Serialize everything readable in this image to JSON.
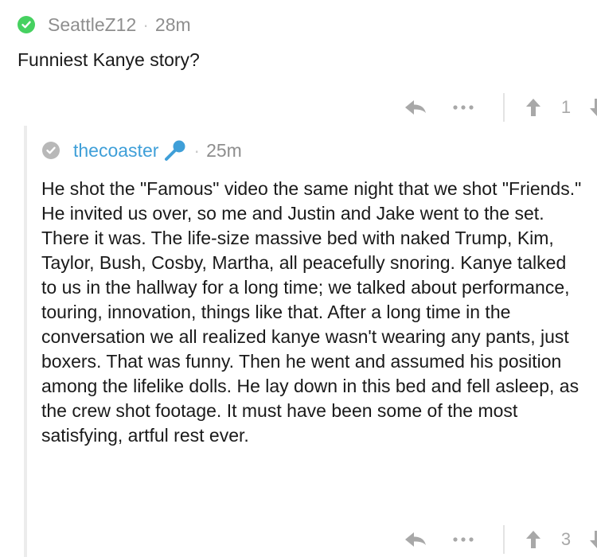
{
  "colors": {
    "text": "#1a1a1a",
    "muted": "#8e8e8e",
    "icon_gray": "#a8a8a8",
    "verified_green": "#46d160",
    "verified_gray": "#b8b8b8",
    "link_blue": "#3f9fd8",
    "thread_line": "#ececec"
  },
  "top_comment": {
    "badge_icon": "check-circle-icon",
    "username": "SeattleZ12",
    "separator": "·",
    "timestamp": "28m",
    "title": "Funniest Kanye story?",
    "actions": {
      "reply_icon": "reply-arrow-icon",
      "more_icon": "more-dots-icon",
      "more_label": "•••",
      "upvote_icon": "arrow-up-icon",
      "score": "1",
      "downvote_icon": "arrow-down-icon"
    }
  },
  "reply": {
    "badge_icon": "check-circle-icon",
    "username": "thecoaster",
    "flair_icon": "microphone-icon",
    "separator": "·",
    "timestamp": "25m",
    "body": "He shot the \"Famous\" video the same night that we shot \"Friends.\" He invited us over, so me and Justin and Jake went to the set. There it was. The life-size massive bed with naked Trump, Kim, Taylor, Bush, Cosby, Martha, all peacefully snoring. Kanye talked to us in the hallway for a long time; we talked about performance, touring, innovation, things like that. After a long time in the conversation we all realized kanye wasn't wearing any pants, just boxers. That was funny. Then he went and assumed his position among the lifelike dolls. He lay down in this bed and fell asleep, as the crew shot footage. It must have been some of the most satisfying, artful rest ever.",
    "actions": {
      "reply_icon": "reply-arrow-icon",
      "more_icon": "more-dots-icon",
      "more_label": "•••",
      "upvote_icon": "arrow-up-icon",
      "score": "3",
      "downvote_icon": "arrow-down-icon"
    }
  }
}
